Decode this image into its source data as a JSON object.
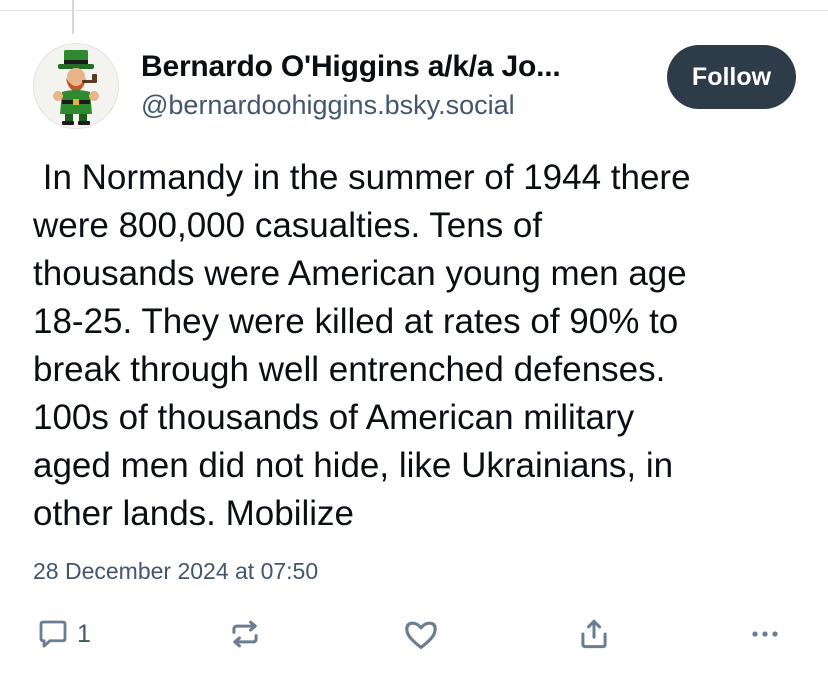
{
  "author": {
    "display_name": "Bernardo O'Higgins a/k/a Jo...",
    "handle": "@bernardoohiggins.bsky.social",
    "avatar": "leprechaun-avatar"
  },
  "follow_button": {
    "label": "Follow"
  },
  "post": {
    "lines": [
      " In Normandy in the summer of 1944 there",
      "were 800,000 casualties. Tens of",
      "thousands were American young men age",
      "18-25. They were killed at rates of 90% to",
      "break through well entrenched defenses.",
      "100s of thousands of American military",
      "aged men did not hide, like Ukrainians, in",
      "other lands. Mobilize"
    ],
    "timestamp": "28 December 2024 at 07:50"
  },
  "actions": {
    "reply": {
      "icon": "reply-icon",
      "count": "1"
    },
    "repost": {
      "icon": "repost-icon"
    },
    "like": {
      "icon": "heart-icon"
    },
    "share": {
      "icon": "share-icon"
    },
    "more": {
      "icon": "more-icon"
    }
  },
  "colors": {
    "text": "#0b0f14",
    "secondary": "#42576c",
    "button": "#2e3c4a",
    "icon": "#6b7d90"
  }
}
